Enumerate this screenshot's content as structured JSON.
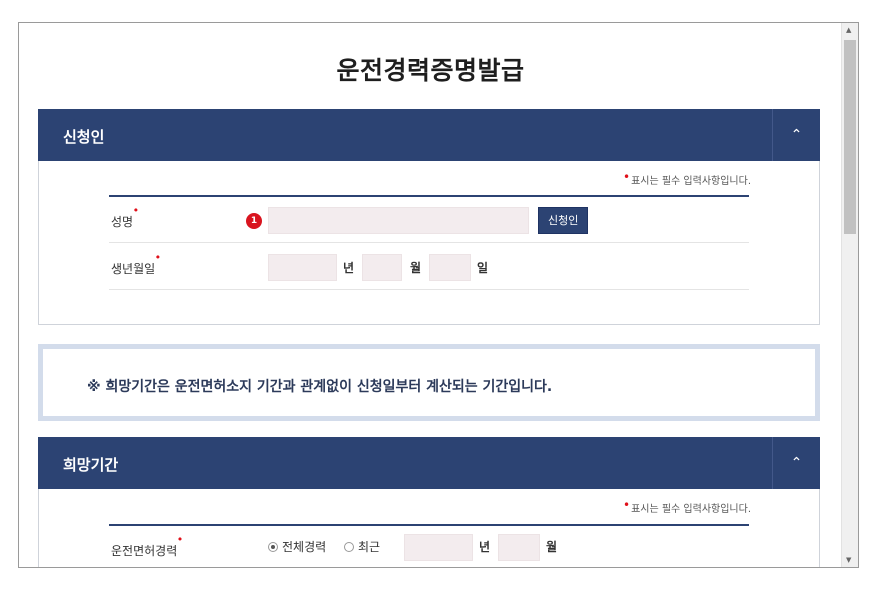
{
  "page": {
    "title": "운전경력증명발급"
  },
  "applicant": {
    "title": "신청인",
    "toggle_icon": "chevron-up",
    "required_note": "표시는 필수 입력사항입니다.",
    "name_label": "성명",
    "badge": "1",
    "applicant_button": "신청인",
    "birth_label": "생년월일",
    "year_unit": "년",
    "month_unit": "월",
    "day_unit": "일"
  },
  "notice": {
    "text": "※ 희망기간은 운전면허소지 기간과 관계없이 신청일부터 계산되는 기간입니다."
  },
  "period": {
    "title": "희망기간",
    "toggle_icon": "chevron-up",
    "required_note": "표시는 필수 입력사항입니다.",
    "career_label": "운전면허경력",
    "option_all": "전체경력",
    "option_recent": "최근",
    "year_unit": "년",
    "month_unit": "월",
    "selected": "전체경력"
  },
  "colors": {
    "header": "#2c4373",
    "required": "#e0101a",
    "field_bg": "#f3ecee",
    "notice_border": "#d3dceb"
  }
}
